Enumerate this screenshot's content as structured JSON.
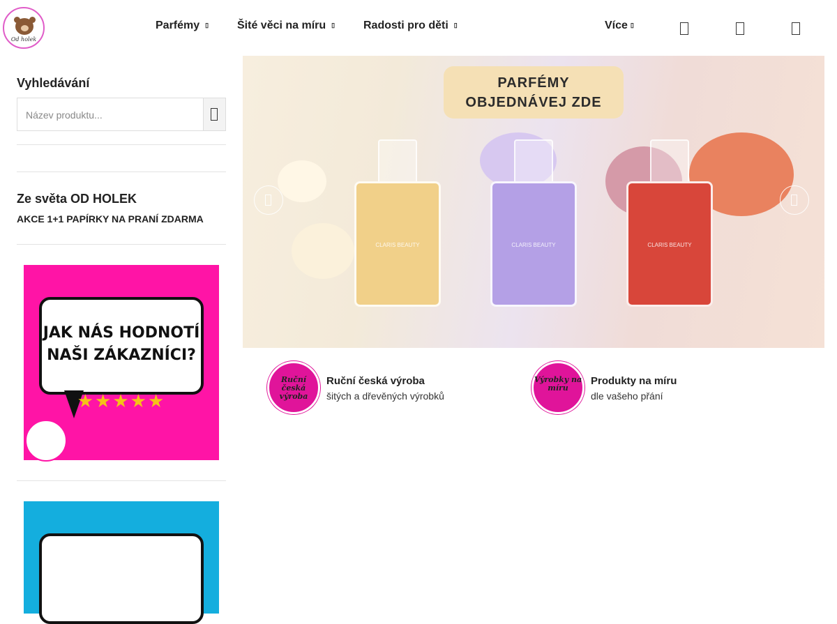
{
  "header": {
    "logo_text": "Od holek",
    "nav": [
      {
        "label": "Parfémy"
      },
      {
        "label": "Šité věci na míru"
      },
      {
        "label": "Radosti pro děti"
      },
      {
        "label": "Více"
      }
    ]
  },
  "sidebar": {
    "search_heading": "Vyhledávání",
    "search_placeholder": "Název produktu...",
    "blog_heading": "Ze světa OD HOLEK",
    "blog_link": "AKCE 1+1 PAPÍRKY NA PRANÍ ZDARMA",
    "banner_text_line1": "JAK NÁS HODNOTÍ",
    "banner_text_line2": "NAŠI ZÁKAZNÍCI?",
    "banner_stars": "★★★★★",
    "banner_colors": {
      "pink": "#ff14a6",
      "blue": "#14aede"
    }
  },
  "hero": {
    "tag_line1": "PARFÉMY",
    "tag_line2": "OBJEDNÁVEJ ZDE",
    "bottle_brand": "CLARIS BEAUTY",
    "bottles": [
      {
        "color": "#f1d089"
      },
      {
        "color": "#b4a0e6"
      },
      {
        "color": "#d8463a"
      }
    ]
  },
  "features": [
    {
      "badge": "Ruční česká výroba",
      "title": "Ruční česká výroba",
      "subtitle": "šitých a dřevěných výrobků"
    },
    {
      "badge": "Výrobky na míru",
      "title": "Produkty na míru",
      "subtitle": "dle vašeho přání"
    }
  ]
}
